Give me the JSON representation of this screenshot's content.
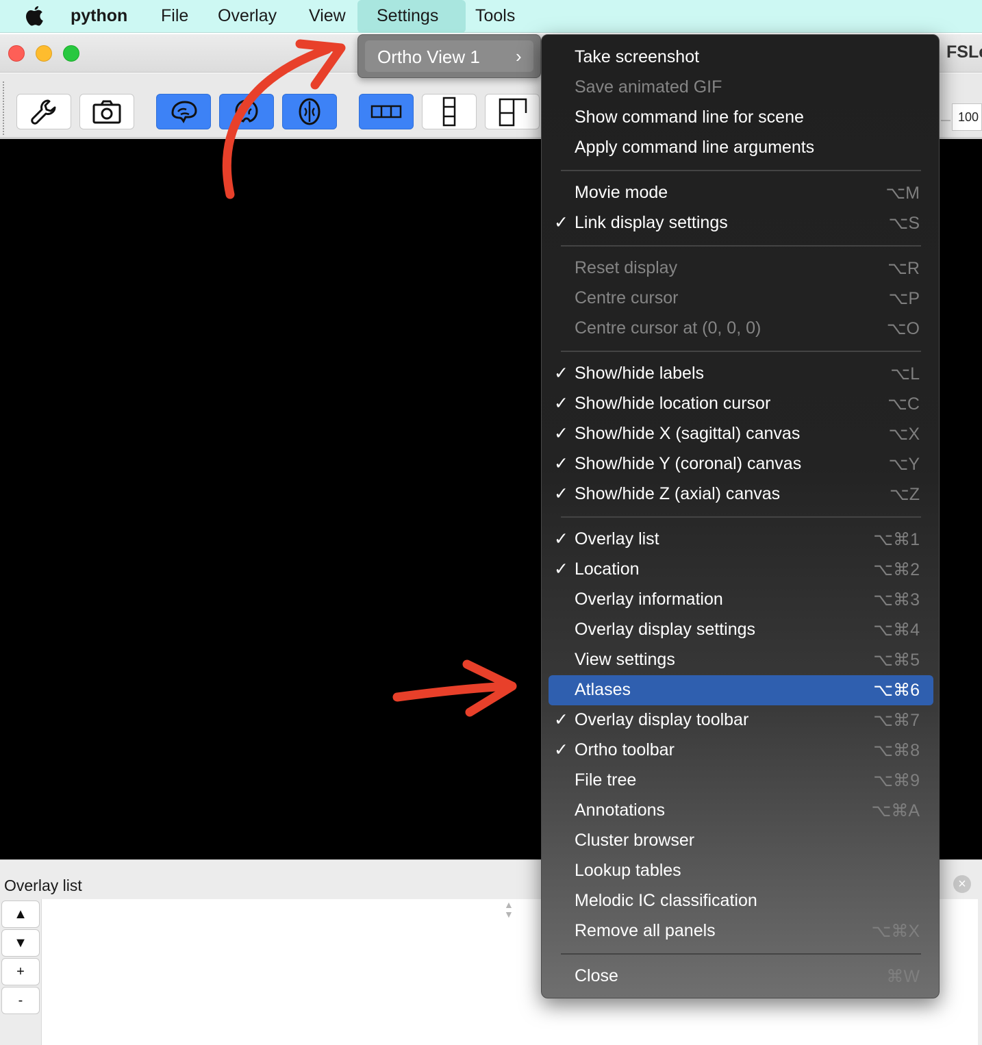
{
  "menubar": {
    "app_name": "python",
    "items": [
      "File",
      "Overlay",
      "View",
      "Settings",
      "Tools"
    ],
    "active_item": "Settings"
  },
  "window": {
    "title": "FSLe"
  },
  "toolbar": {
    "zoom_value": "100"
  },
  "view_submenu": {
    "label": "Ortho View 1",
    "chevron": "›"
  },
  "settings_menu": {
    "sections": [
      [
        {
          "label": "Take screenshot",
          "enabled": true,
          "checked": false,
          "shortcut": ""
        },
        {
          "label": "Save animated GIF",
          "enabled": false,
          "checked": false,
          "shortcut": ""
        },
        {
          "label": "Show command line for scene",
          "enabled": true,
          "checked": false,
          "shortcut": ""
        },
        {
          "label": "Apply command line arguments",
          "enabled": true,
          "checked": false,
          "shortcut": ""
        }
      ],
      [
        {
          "label": "Movie mode",
          "enabled": true,
          "checked": false,
          "shortcut": "⌥M"
        },
        {
          "label": "Link display settings",
          "enabled": true,
          "checked": true,
          "shortcut": "⌥S"
        }
      ],
      [
        {
          "label": "Reset display",
          "enabled": false,
          "checked": false,
          "shortcut": "⌥R"
        },
        {
          "label": "Centre cursor",
          "enabled": false,
          "checked": false,
          "shortcut": "⌥P"
        },
        {
          "label": "Centre cursor at (0, 0, 0)",
          "enabled": false,
          "checked": false,
          "shortcut": "⌥O"
        }
      ],
      [
        {
          "label": "Show/hide labels",
          "enabled": true,
          "checked": true,
          "shortcut": "⌥L"
        },
        {
          "label": "Show/hide location cursor",
          "enabled": true,
          "checked": true,
          "shortcut": "⌥C"
        },
        {
          "label": "Show/hide X (sagittal) canvas",
          "enabled": true,
          "checked": true,
          "shortcut": "⌥X"
        },
        {
          "label": "Show/hide Y (coronal) canvas",
          "enabled": true,
          "checked": true,
          "shortcut": "⌥Y"
        },
        {
          "label": "Show/hide Z (axial) canvas",
          "enabled": true,
          "checked": true,
          "shortcut": "⌥Z"
        }
      ],
      [
        {
          "label": "Overlay list",
          "enabled": true,
          "checked": true,
          "shortcut": "⌥⌘1"
        },
        {
          "label": "Location",
          "enabled": true,
          "checked": true,
          "shortcut": "⌥⌘2"
        },
        {
          "label": "Overlay information",
          "enabled": true,
          "checked": false,
          "shortcut": "⌥⌘3"
        },
        {
          "label": "Overlay display settings",
          "enabled": true,
          "checked": false,
          "shortcut": "⌥⌘4"
        },
        {
          "label": "View settings",
          "enabled": true,
          "checked": false,
          "shortcut": "⌥⌘5"
        },
        {
          "label": "Atlases",
          "enabled": true,
          "checked": false,
          "shortcut": "⌥⌘6",
          "highlighted": true
        },
        {
          "label": "Overlay display toolbar",
          "enabled": true,
          "checked": true,
          "shortcut": "⌥⌘7"
        },
        {
          "label": "Ortho toolbar",
          "enabled": true,
          "checked": true,
          "shortcut": "⌥⌘8"
        },
        {
          "label": "File tree",
          "enabled": true,
          "checked": false,
          "shortcut": "⌥⌘9"
        },
        {
          "label": "Annotations",
          "enabled": true,
          "checked": false,
          "shortcut": "⌥⌘A"
        },
        {
          "label": "Cluster browser",
          "enabled": true,
          "checked": false,
          "shortcut": ""
        },
        {
          "label": "Lookup tables",
          "enabled": true,
          "checked": false,
          "shortcut": ""
        },
        {
          "label": "Melodic IC classification",
          "enabled": true,
          "checked": false,
          "shortcut": ""
        },
        {
          "label": "Remove all panels",
          "enabled": true,
          "checked": false,
          "shortcut": "⌥⌘X"
        }
      ],
      [
        {
          "label": "Close",
          "enabled": true,
          "checked": false,
          "shortcut": "⌘W"
        }
      ]
    ]
  },
  "overlay_panel": {
    "title": "Overlay list",
    "buttons": [
      "▲",
      "▼",
      "+",
      "-"
    ],
    "close_glyph": "×"
  },
  "colors": {
    "menubar_bg": "#cdf8f3",
    "highlight": "#2f5faf",
    "toggle_on": "#3d82f6",
    "annotation_arrow": "#e8402a"
  }
}
